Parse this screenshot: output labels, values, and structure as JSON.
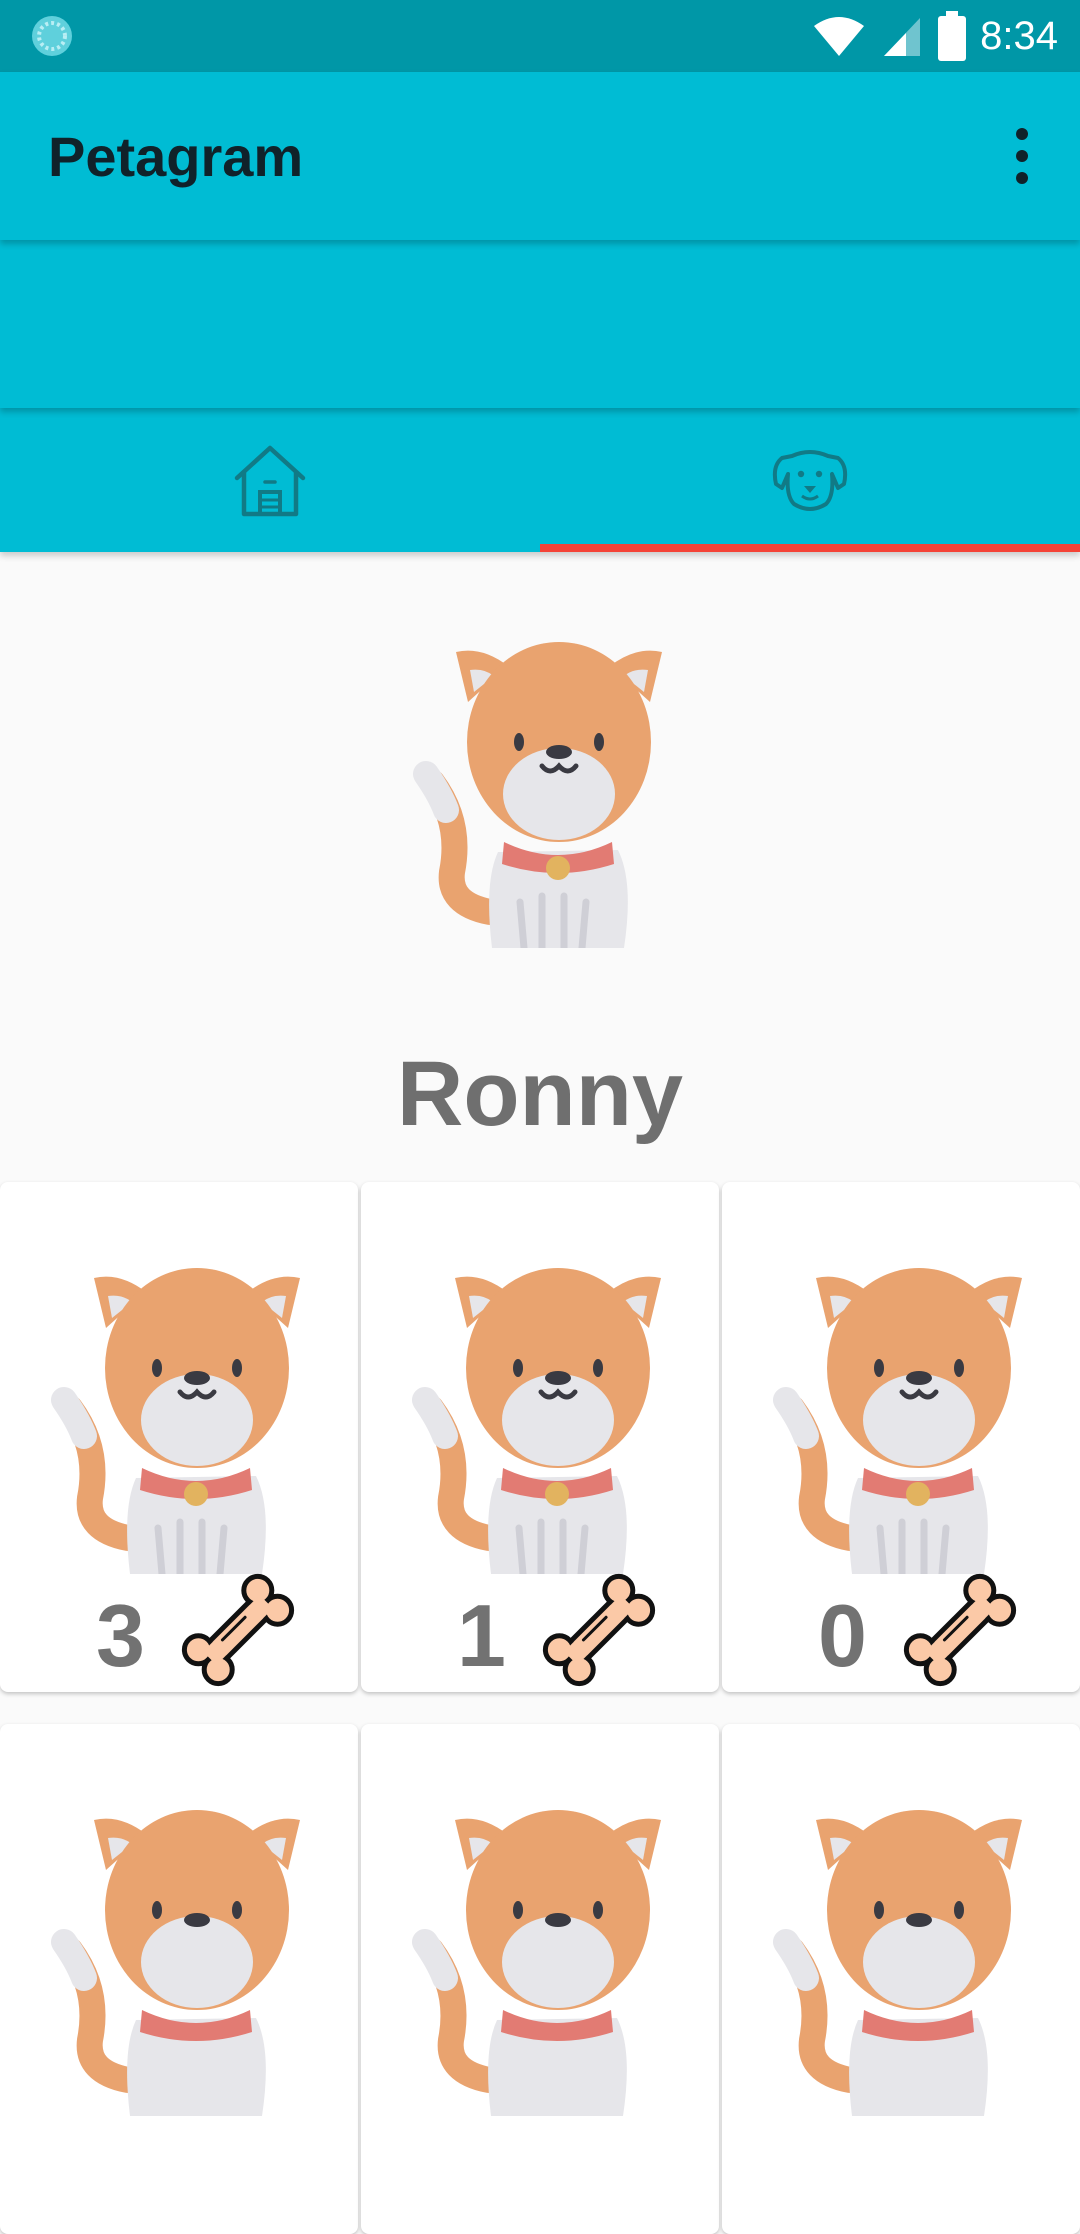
{
  "status_bar": {
    "time": "8:34",
    "icons": [
      "notification-dot-icon",
      "wifi-icon",
      "signal-icon",
      "battery-icon"
    ]
  },
  "app_bar": {
    "title": "Petagram",
    "menu_icon": "more-vert-icon"
  },
  "tabs": [
    {
      "icon": "house-icon",
      "selected": false
    },
    {
      "icon": "dog-icon",
      "selected": true
    }
  ],
  "profile": {
    "name": "Ronny",
    "photo_icon": "cat-icon"
  },
  "photos": [
    {
      "likes": "3",
      "like_icon": "bone-icon"
    },
    {
      "likes": "1",
      "like_icon": "bone-icon"
    },
    {
      "likes": "0",
      "like_icon": "bone-icon"
    },
    {
      "likes": "",
      "like_icon": "bone-icon"
    },
    {
      "likes": "",
      "like_icon": "bone-icon"
    },
    {
      "likes": "",
      "like_icon": "bone-icon"
    }
  ],
  "colors": {
    "primary": "#00bcd4",
    "primary_dark": "#0097a7",
    "accent": "#f44336",
    "text_dark": "#10222a",
    "text_gray": "#6f6f6f"
  }
}
